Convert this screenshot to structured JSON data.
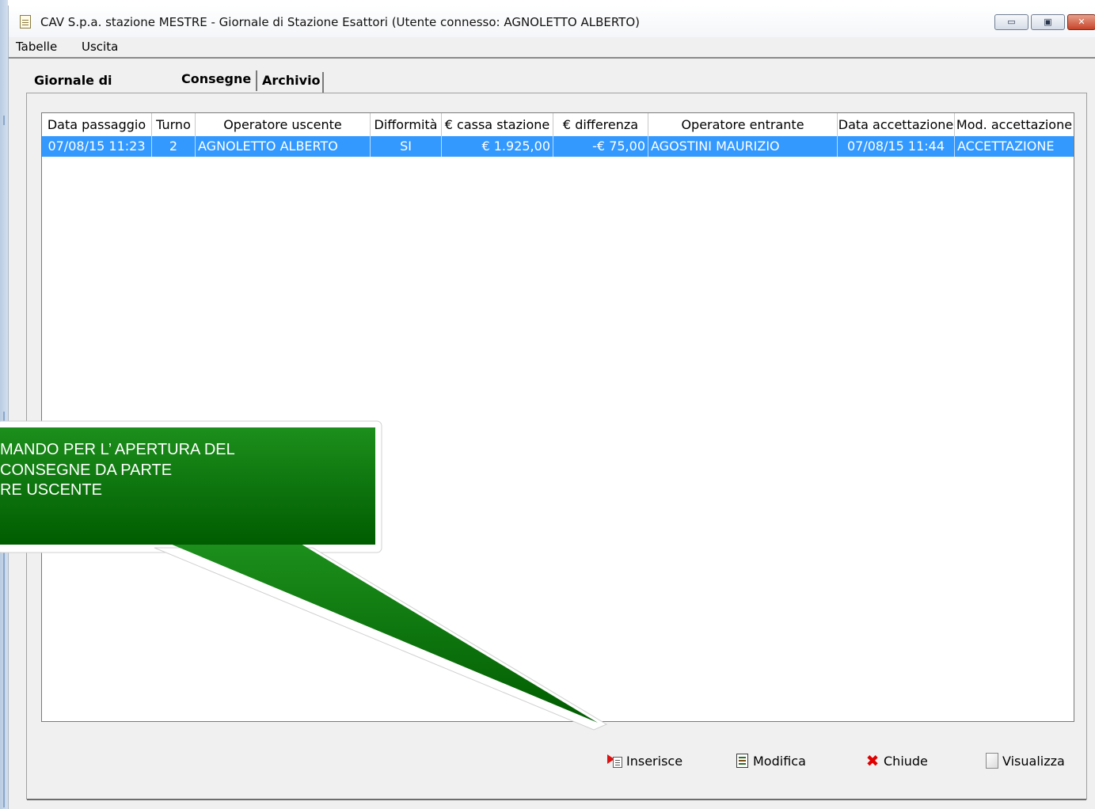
{
  "window": {
    "title": "CAV S.p.a. stazione MESTRE - Giornale di Stazione Esattori (Utente connesso: AGNOLETTO ALBERTO)",
    "controls": {
      "minimize": "▭",
      "maximize": "▣",
      "close": "✕"
    }
  },
  "menu": {
    "items": [
      "Tabelle",
      "Uscita"
    ]
  },
  "tabs": [
    {
      "label": "Giornale di Stazione",
      "active": false
    },
    {
      "label": "Consegne",
      "active": true
    },
    {
      "label": "Archivio",
      "active": false
    }
  ],
  "table": {
    "columns": [
      "Data passaggio",
      "Turno",
      "Operatore uscente",
      "Difformità",
      "€ cassa stazione",
      "€ differenza",
      "Operatore entrante",
      "Data accettazione",
      "Mod. accettazione"
    ],
    "rows": [
      [
        "07/08/15 11:23",
        "2",
        "AGNOLETTO ALBERTO",
        "SI",
        "€ 1.925,00",
        "-€ 75,00",
        "AGOSTINI MAURIZIO",
        "07/08/15 11:44",
        "ACCETTAZIONE"
      ]
    ],
    "selected_row_color": "#3399ff"
  },
  "buttons": {
    "insert": {
      "label": "Inserisce",
      "icon": "insert-document-icon"
    },
    "edit": {
      "label": "Modifica",
      "icon": "edit-document-icon"
    },
    "close": {
      "label": "Chiude",
      "icon": "close-x-icon"
    },
    "view": {
      "label": "Visualizza",
      "icon": "view-document-icon"
    }
  },
  "callout": {
    "lines": [
      "MANDO PER L’ APERTURA DEL",
      "CONSEGNE DA PARTE",
      "RE USCENTE"
    ],
    "color": "#0a7a0a"
  }
}
